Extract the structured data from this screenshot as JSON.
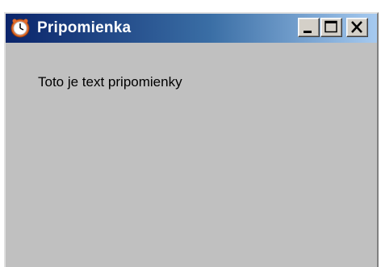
{
  "window": {
    "title": "Pripomienka",
    "app_icon": "alarm-clock-icon",
    "controls": {
      "minimize_icon": "minimize-icon",
      "maximize_icon": "maximize-icon",
      "close_icon": "close-icon"
    }
  },
  "content": {
    "message": "Toto je text pripomienky"
  },
  "colors": {
    "titlebar_start": "#0a246a",
    "titlebar_end": "#a6caf0",
    "window_bg": "#c0c0c0"
  }
}
